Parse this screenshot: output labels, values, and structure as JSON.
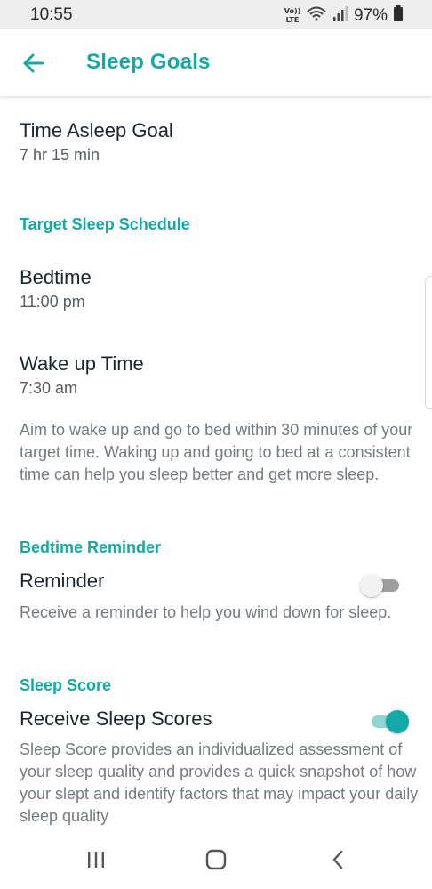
{
  "status_bar": {
    "time": "10:55",
    "network_label": "Vo)) LTE",
    "battery_percent": "97%"
  },
  "app_bar": {
    "title": "Sleep Goals"
  },
  "time_asleep": {
    "title": "Time Asleep Goal",
    "value": "7 hr 15 min"
  },
  "target_schedule": {
    "header": "Target Sleep Schedule",
    "bedtime_title": "Bedtime",
    "bedtime_value": "11:00 pm",
    "wake_title": "Wake up Time",
    "wake_value": "7:30 am",
    "description": "Aim to wake up and go to bed within 30 minutes of your target time. Waking up and going to bed at a consistent time can help you sleep better and get more sleep."
  },
  "bedtime_reminder": {
    "header": "Bedtime Reminder",
    "title": "Reminder",
    "enabled": false,
    "description": "Receive a reminder to help you wind down for sleep."
  },
  "sleep_score": {
    "header": "Sleep Score",
    "title": "Receive Sleep Scores",
    "enabled": true,
    "description": "Sleep Score provides an individualized assessment of your sleep quality and provides a quick snapshot of how your slept and identify factors that may impact your daily sleep quality"
  },
  "colors": {
    "accent": "#14a8a6",
    "toggle_off_knob": "#f2f2f2",
    "toggle_off_track": "#9e9e9e",
    "toggle_on_track": "#8fd6d3"
  },
  "icons": {
    "back": "arrow-left-icon",
    "recents": "recents-icon",
    "home": "home-icon",
    "nav_back": "chevron-left-icon"
  }
}
